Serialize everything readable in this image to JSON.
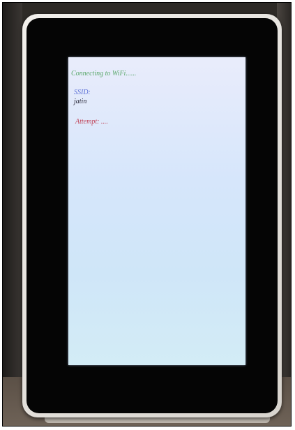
{
  "screen": {
    "status_text": "Connecting to WiFi......",
    "ssid_label": "SSID:",
    "ssid_value": "jatin",
    "attempt_text": "Attempt: ....",
    "colors": {
      "status": "#5aa86a",
      "ssid_label": "#5b6fd6",
      "ssid_value": "#2a2a3a",
      "attempt": "#c0455a",
      "screen_bg": "#dbe8fb"
    }
  }
}
